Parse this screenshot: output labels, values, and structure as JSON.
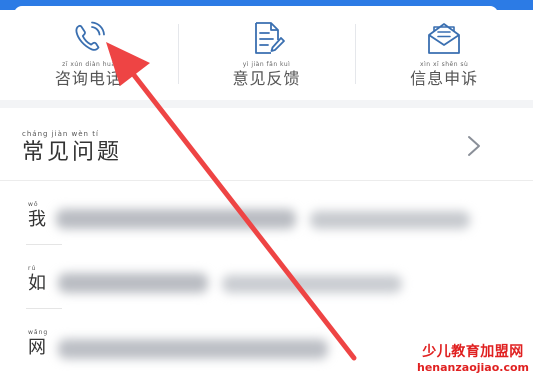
{
  "quick_actions": [
    {
      "pinyin": "zī  xún  diàn  huà",
      "label": "咨询电话",
      "icon": "phone-icon"
    },
    {
      "pinyin": "yì  jiàn  fǎn  kuì",
      "label": "意见反馈",
      "icon": "document-edit-icon"
    },
    {
      "pinyin": "xìn  xī  shēn  sù",
      "label": "信息申诉",
      "icon": "envelope-open-icon"
    }
  ],
  "faq": {
    "title_pinyin": "cháng  jiàn  wèn  tí",
    "title": "常见问题",
    "chevron_icon": "chevron-right-icon",
    "rows": [
      {
        "pinyin": "wǒ",
        "lead": "我",
        "text_obscured": true
      },
      {
        "pinyin": "rú",
        "lead": "如",
        "text_obscured": true
      },
      {
        "pinyin": "wǎng",
        "lead": "网",
        "text_obscured": true
      }
    ]
  },
  "watermark": {
    "cn": "少儿教育加盟网",
    "url": "henanzaojiao.com"
  },
  "colors": {
    "header_blue": "#2c7be5",
    "icon_blue": "#3a6fb0",
    "arrow_red": "#ee4444",
    "watermark_red": "#e02020"
  }
}
